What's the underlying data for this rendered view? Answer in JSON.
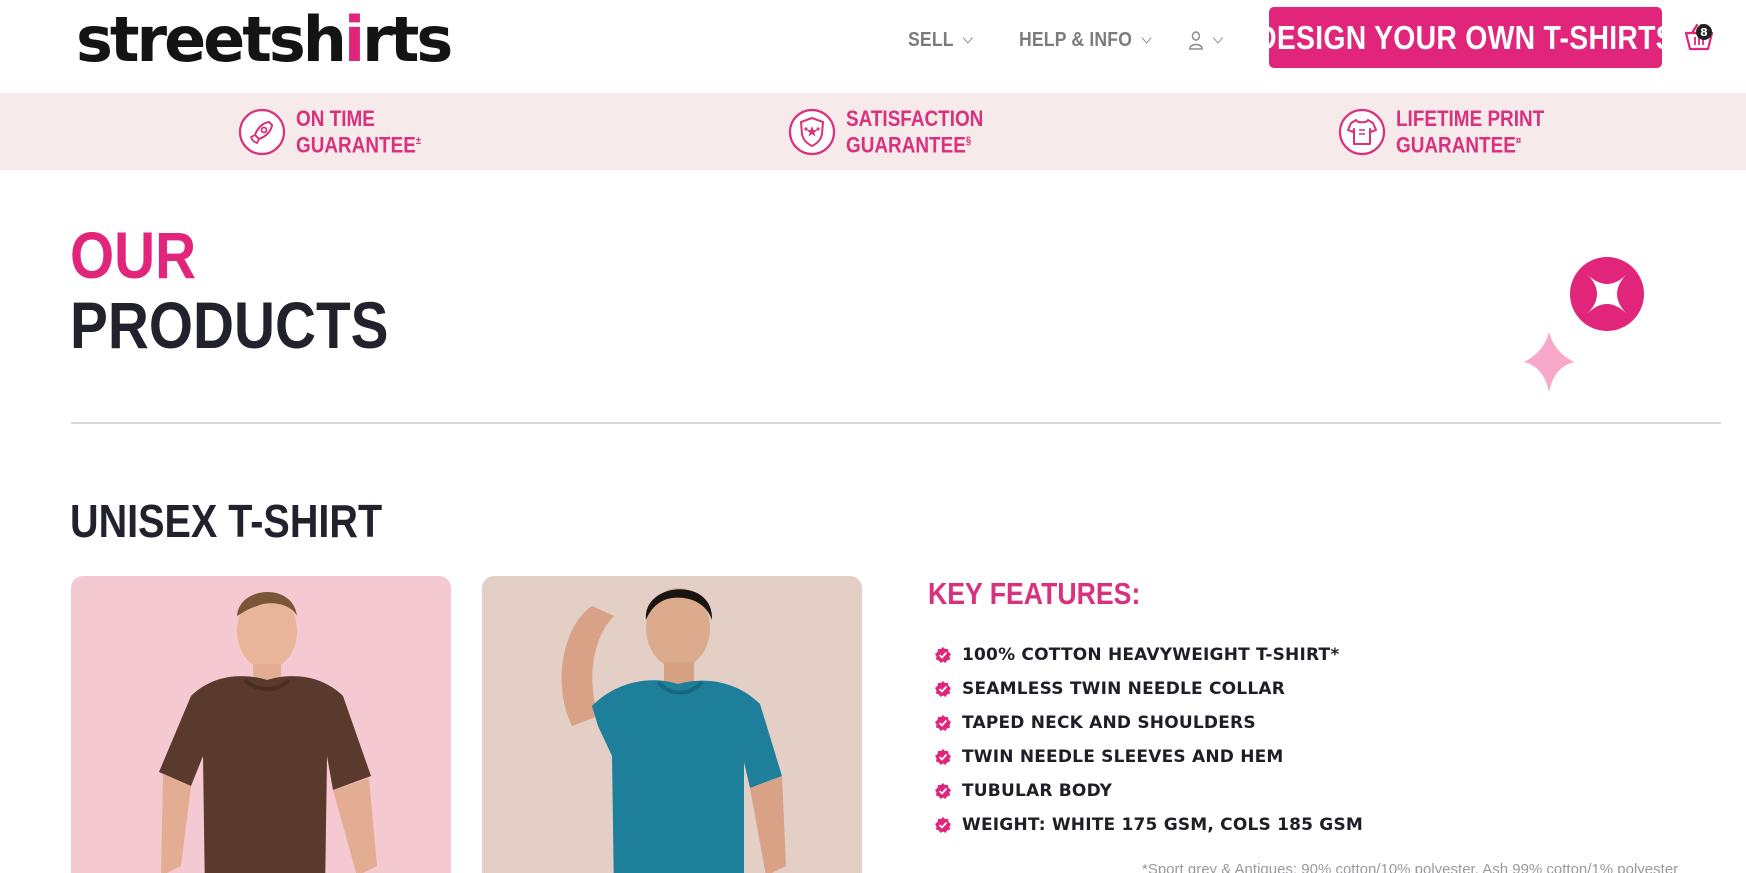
{
  "brand": {
    "logo_part1": "streetsh",
    "logo_part2": "i",
    "logo_part3": "rts",
    "accent_color": "#e0257a",
    "band_color": "#f6eaea"
  },
  "nav": {
    "sell_label": "SELL",
    "help_label": "HELP & INFO",
    "user_icon": "user-icon",
    "cta_label": "DESIGN YOUR OWN T-SHIRTS",
    "basket_icon": "basket-icon",
    "basket_count": "8"
  },
  "guarantees": [
    {
      "line1": "ON TIME",
      "line2": "GUARANTEE",
      "mark": "±",
      "icon": "rocket-icon"
    },
    {
      "line1": "SATISFACTION",
      "line2": "GUARANTEE",
      "mark": "§",
      "icon": "shield-stars-icon"
    },
    {
      "line1": "LIFETIME PRINT",
      "line2": "GUARANTEE",
      "mark": "¤",
      "icon": "tshirt-icon"
    }
  ],
  "hero": {
    "line1": "OUR",
    "line2": "PRODUCTS"
  },
  "product": {
    "title": "UNISEX T-SHIRT",
    "images": [
      {
        "alt": "brown t-shirt model",
        "color": "#5a3a2c"
      },
      {
        "alt": "teal t-shirt model",
        "color": "#1e7f9a"
      }
    ],
    "features_title": "KEY FEATURES:",
    "features": [
      "100% COTTON HEAVYWEIGHT T-SHIRT*",
      "SEAMLESS TWIN NEEDLE COLLAR",
      "TAPED NECK AND SHOULDERS",
      "TWIN NEEDLE SLEEVES AND HEM",
      "TUBULAR BODY",
      "WEIGHT: WHITE 175 GSM, COLS 185 GSM"
    ],
    "footnote": "*Sport grey & Antiques: 90% cotton/10% polyester, Ash 99% cotton/1% polyester"
  }
}
